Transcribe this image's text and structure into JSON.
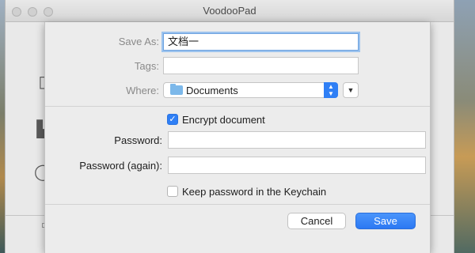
{
  "window": {
    "title": "VoodooPad"
  },
  "sheet": {
    "save_as_label": "Save As:",
    "save_as_value": "文档一",
    "tags_label": "Tags:",
    "tags_value": "",
    "where_label": "Where:",
    "where_value": "Documents",
    "encrypt_label": "Encrypt document",
    "encrypt_checked": true,
    "password_label": "Password:",
    "password_value": "",
    "password_again_label": "Password (again):",
    "password_again_value": "",
    "keychain_label": "Keep password in the Keychain",
    "keychain_checked": false,
    "cancel_label": "Cancel",
    "save_label": "Save"
  },
  "icons": {
    "where_folder": "folder-icon",
    "where_stepper": "up-down-chevron-icon",
    "expand": "chevron-down-icon",
    "encrypt_check": "checkmark-icon"
  },
  "colors": {
    "accent": "#2f7ff5",
    "focus_ring": "#9cc3ee"
  }
}
